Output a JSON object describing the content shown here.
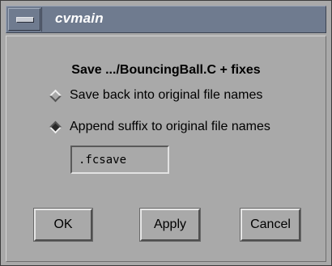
{
  "window": {
    "title": "cvmain"
  },
  "dialog": {
    "heading": "Save .../BouncingBall.C + fixes",
    "options": [
      {
        "label": "Save back into original file names",
        "selected": false
      },
      {
        "label": "Append suffix to original file names",
        "selected": true
      }
    ],
    "suffix_value": ".fcsave"
  },
  "buttons": {
    "ok": "OK",
    "apply": "Apply",
    "cancel": "Cancel"
  },
  "icons": {
    "window_menu": "window-menu-icon",
    "radio_off": "radio-diamond-off-icon",
    "radio_on": "radio-diamond-on-icon"
  },
  "colors": {
    "title_bar": "#6f7b8f",
    "dialog_background": "#a9a9a9",
    "title_text": "#ffffff"
  }
}
